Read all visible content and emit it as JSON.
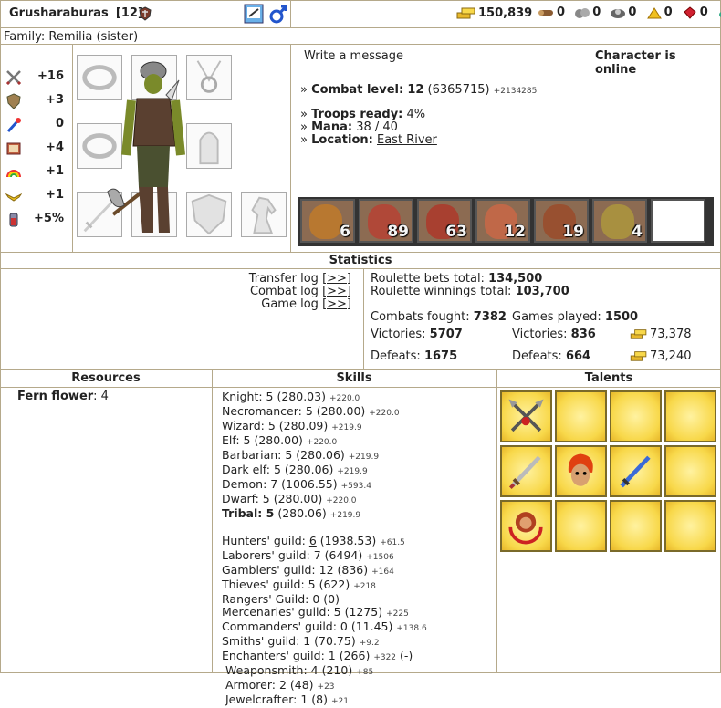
{
  "header": {
    "name": "Grusharaburas",
    "level": "[12]",
    "gold": "150,839",
    "resources": [
      "0",
      "0",
      "0",
      "0",
      "0",
      "0"
    ]
  },
  "family": "Family: Remilia (sister)",
  "stats": [
    {
      "icon": "attack-icon",
      "value": "+16"
    },
    {
      "icon": "defense-icon",
      "value": "+3"
    },
    {
      "icon": "spellpower-icon",
      "value": "0"
    },
    {
      "icon": "knowledge-icon",
      "value": "+4"
    },
    {
      "icon": "luck-icon",
      "value": "+1"
    },
    {
      "icon": "morale-icon",
      "value": "+1"
    },
    {
      "icon": "initiative-icon",
      "value": "+5%"
    }
  ],
  "info": {
    "write_message": "Write a message",
    "online": "Character is online",
    "combat_label": "Combat level:",
    "combat_level": "12",
    "combat_exp": "(6365715)",
    "combat_exp_next": "+2134285",
    "troops_label": "Troops ready:",
    "troops": "4%",
    "mana_label": "Mana:",
    "mana": "38 / 40",
    "location_label": "Location:",
    "location": "East River",
    "bullet": "»"
  },
  "units": [
    "6",
    "89",
    "63",
    "12",
    "19",
    "4"
  ],
  "statistics": {
    "title": "Statistics",
    "transfer_log": "Transfer log",
    "combat_log": "Combat log",
    "game_log": "Game log",
    "link": "[>>]",
    "bets_label": "Roulette bets total:",
    "bets": "134,500",
    "winnings_label": "Roulette winnings total:",
    "winnings": "103,700",
    "combats_label": "Combats fought:",
    "combats": "7382",
    "victories_label": "Victories:",
    "victories": "5707",
    "defeats_label": "Defeats:",
    "defeats": "1675",
    "games_label": "Games played:",
    "games": "1500",
    "gvictories": "836",
    "gdefeats": "664",
    "gold_won": "73,378",
    "gold_lost": "73,240"
  },
  "columns": {
    "resources": "Resources",
    "skills": "Skills",
    "talents": "Talents"
  },
  "resource_item": {
    "name": "Fern flower",
    "count": ": 4"
  },
  "skills": [
    {
      "name": "Knight",
      "lvl": ": 5 (280.03)",
      "delta": "+220.0",
      "bold": false
    },
    {
      "name": "Necromancer",
      "lvl": ": 5 (280.00)",
      "delta": "+220.0",
      "bold": false
    },
    {
      "name": "Wizard",
      "lvl": ": 5 (280.09)",
      "delta": "+219.9",
      "bold": false
    },
    {
      "name": "Elf",
      "lvl": ": 5 (280.00)",
      "delta": "+220.0",
      "bold": false
    },
    {
      "name": "Barbarian",
      "lvl": ": 5 (280.06)",
      "delta": "+219.9",
      "bold": false
    },
    {
      "name": "Dark elf",
      "lvl": ": 5 (280.06)",
      "delta": "+219.9",
      "bold": false
    },
    {
      "name": "Demon",
      "lvl": ": 7 (1006.55)",
      "delta": "+593.4",
      "bold": false
    },
    {
      "name": "Dwarf",
      "lvl": ": 5 (280.00)",
      "delta": "+220.0",
      "bold": false
    },
    {
      "name": "Tribal",
      "lvl": ": 5",
      "extra": " (280.06)",
      "delta": "+219.9",
      "bold": true
    }
  ],
  "guilds": [
    {
      "name": "Hunters' guild:",
      "pre": " ",
      "link": "6",
      "post": " (1938.53)",
      "delta": "+61.5"
    },
    {
      "name": "Laborers' guild:",
      "pre": " 7 (6494)",
      "link": "",
      "post": "",
      "delta": "+1506"
    },
    {
      "name": "Gamblers' guild:",
      "pre": " 12 (836)",
      "link": "",
      "post": "",
      "delta": "+164"
    },
    {
      "name": "Thieves' guild:",
      "pre": " 5 (622)",
      "link": "",
      "post": "",
      "delta": "+218"
    },
    {
      "name": "Rangers' Guild:",
      "pre": " 0 (0)",
      "link": "",
      "post": "",
      "delta": ""
    },
    {
      "name": "Mercenaries' guild:",
      "pre": " 5 (1275)",
      "link": "",
      "post": "",
      "delta": "+225"
    },
    {
      "name": "Commanders' guild:",
      "pre": " 0 (11.45)",
      "link": "",
      "post": "",
      "delta": "+138.6"
    },
    {
      "name": "Smiths' guild:",
      "pre": " 1 (70.75)",
      "link": "",
      "post": "",
      "delta": "+9.2"
    },
    {
      "name": "Enchanters' guild:",
      "pre": " 1 (266)",
      "link": "",
      "post": "",
      "delta": "+322",
      "tail": "(-)"
    },
    {
      "name": " Weaponsmith:",
      "pre": " 4 (210)",
      "link": "",
      "post": "",
      "delta": "+85"
    },
    {
      "name": " Armorer:",
      "pre": " 2 (48)",
      "link": "",
      "post": "",
      "delta": "+23"
    },
    {
      "name": " Jewelcrafter:",
      "pre": " 1 (8)",
      "link": "",
      "post": "",
      "delta": "+21"
    }
  ],
  "colors": {
    "border": "#b5a98b",
    "gold": "#e8b82a",
    "talent_bg": "#f8d84a"
  }
}
